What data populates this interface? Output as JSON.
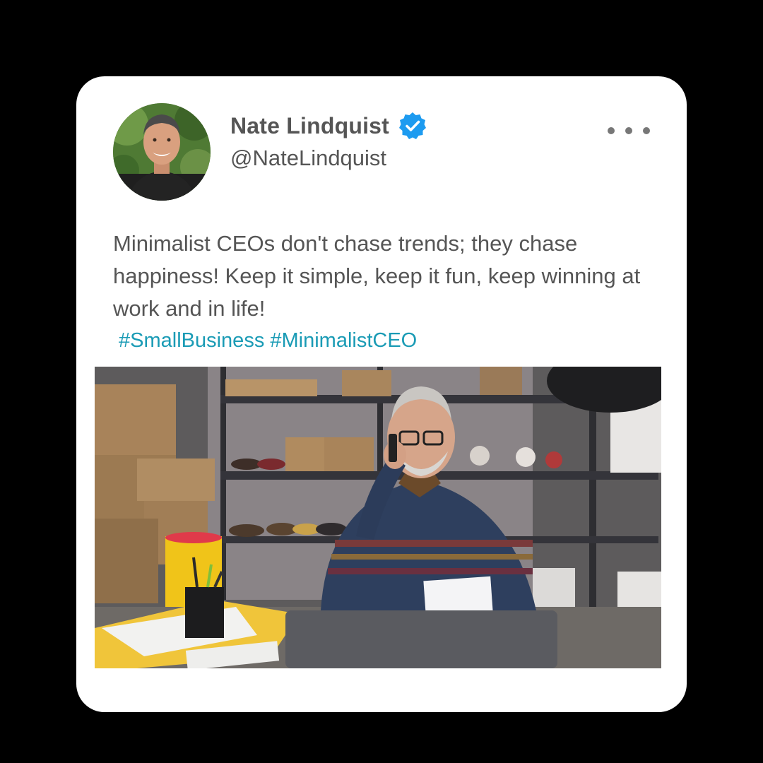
{
  "tweet": {
    "author": {
      "name": "Nate Lindquist",
      "handle": "@NateLindquist",
      "verified": true
    },
    "text": "Minimalist CEOs don't chase trends; they chase happiness! Keep it simple, keep it fun, keep winning at work and in life!",
    "hashtags": "#SmallBusiness #MinimalistCEO"
  },
  "icons": {
    "verified": "verified-badge-icon",
    "more": "more-options-icon"
  },
  "colors": {
    "background": "#000000",
    "card": "#ffffff",
    "text": "#555555",
    "hashtag": "#1a9bb5",
    "verified": "#1d9bf0"
  }
}
